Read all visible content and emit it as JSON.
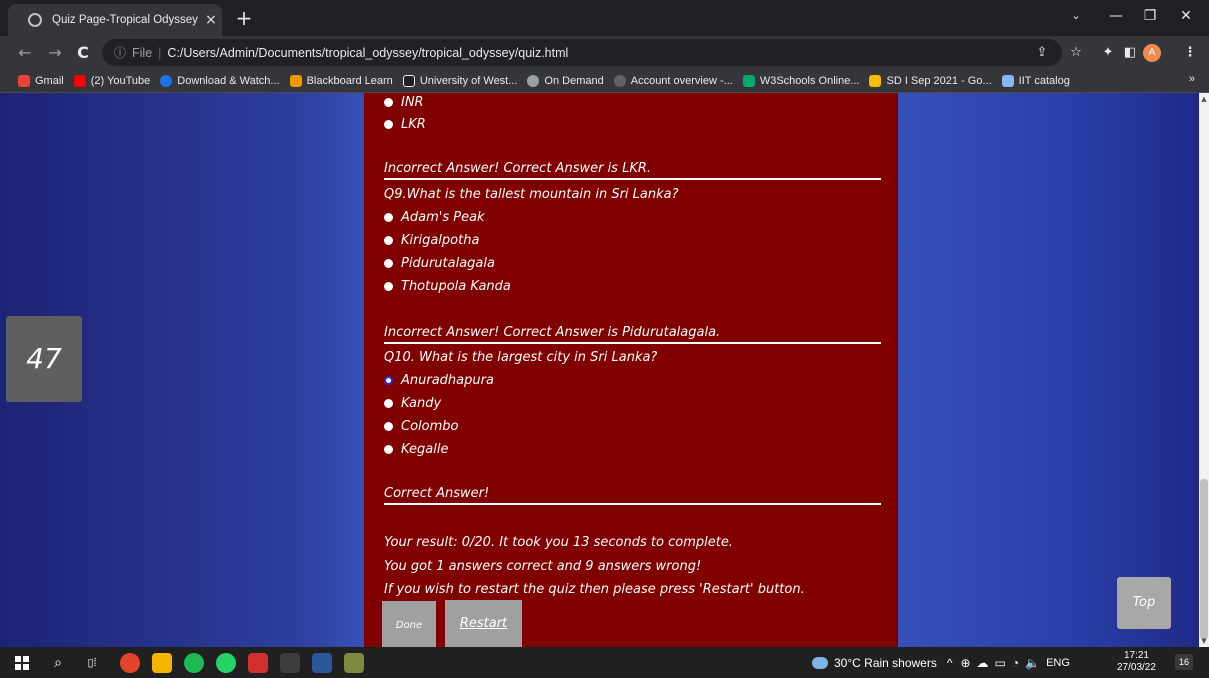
{
  "browser": {
    "tab_title": "Quiz Page-Tropical Odyssey",
    "tab_close": "×",
    "new_tab": "+",
    "win_min": "—",
    "win_max": "❐",
    "win_close": "✕",
    "back": "←",
    "forward": "→",
    "reload": "C",
    "address_label": "File",
    "url": "C:/Users/Admin/Documents/tropical_odyssey/tropical_odyssey/quiz.html",
    "avatar_letter": "A",
    "bookmarks": [
      {
        "label": "Gmail",
        "color": "#ea4335"
      },
      {
        "label": "(2) YouTube",
        "color": "#ff0000"
      },
      {
        "label": "Download & Watch...",
        "color": "#1a73e8"
      },
      {
        "label": "Blackboard Learn",
        "color": "#f29900"
      },
      {
        "label": "University of West...",
        "color": "#202124"
      },
      {
        "label": "On Demand",
        "color": "#9aa0a6"
      },
      {
        "label": "Account overview -...",
        "color": "#5f6368"
      },
      {
        "label": "W3Schools Online...",
        "color": "#04aa6d"
      },
      {
        "label": "SD I Sep 2021 - Go...",
        "color": "#fbbc04"
      },
      {
        "label": "IIT catalog",
        "color": "#8ab4f8"
      }
    ],
    "bookmarks_more": "»"
  },
  "quiz": {
    "q8_options": [
      "INR",
      "LKR"
    ],
    "q8_feedback": "Incorrect Answer! Correct Answer is LKR.",
    "q9_text": "Q9.What is the tallest mountain in Sri Lanka?",
    "q9_options": [
      "Adam's Peak",
      "Kirigalpotha",
      "Pidurutalagala",
      "Thotupola Kanda"
    ],
    "q9_feedback": "Incorrect Answer! Correct Answer is Pidurutalagala.",
    "q10_text": "Q10. What is the largest city in Sri Lanka?",
    "q10_options": [
      "Anuradhapura",
      "Kandy",
      "Colombo",
      "Kegalle"
    ],
    "q10_feedback": "Correct Answer!",
    "result_1": "Your result: 0/20. It took you 13 seconds to complete.",
    "result_2": "You got 1 answers correct and 9 answers wrong!",
    "result_3": "If you wish to restart the quiz then please press 'Restart' button.",
    "done_label": "Done",
    "restart_label": "Restart",
    "counter": "47",
    "top_label": "Top"
  },
  "taskbar": {
    "weather": "30°C  Rain showers",
    "lang": "ENG",
    "time": "17:21",
    "date": "27/03/22",
    "notif_count": "16"
  }
}
